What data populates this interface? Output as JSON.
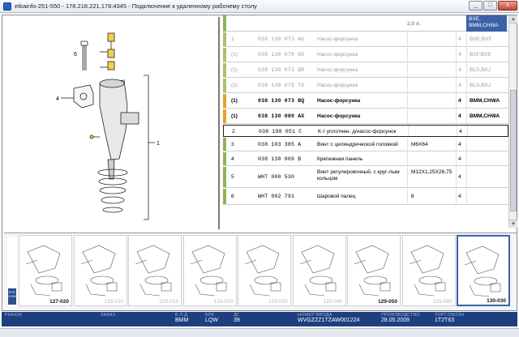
{
  "window": {
    "title": "etkainfo-251-550 - 178.218.221.178:4345 - Подключение к удаленному рабочему столу",
    "buttons": {
      "minimize": "_",
      "restore": "□",
      "close": "x"
    }
  },
  "parts_table": {
    "header": {
      "qualifier": "2,0 л.",
      "model": "BXE, BMM,CHWA"
    },
    "rows": [
      {
        "pos": "1",
        "part_number": "038 130 073 AG",
        "description": "Насос-форсунка",
        "qualifier": "",
        "qty": "4",
        "model": "BXE,BXF",
        "style": "grey",
        "mark": "#a9c06b"
      },
      {
        "pos": "(1)",
        "part_number": "038 130 079 GX",
        "description": "Насос-форсунка",
        "qualifier": "",
        "qty": "4",
        "model": "BXF,BXE",
        "style": "grey",
        "mark": "#a9c06b"
      },
      {
        "pos": "(1)",
        "part_number": "038 130 073 BR",
        "description": "Насос-форсунка",
        "qualifier": "",
        "qty": "4",
        "model": "BLS,BXJ",
        "style": "grey",
        "mark": "#a9c06b"
      },
      {
        "pos": "(1)",
        "part_number": "038 130 079 TX",
        "description": "Насос-форсунка",
        "qualifier": "",
        "qty": "4",
        "model": "BLS,BXJ",
        "style": "grey",
        "mark": "#a9c06b"
      },
      {
        "pos": "(1)",
        "part_number": "038 130 073 BQ",
        "description": "Насос-форсунка",
        "qualifier": "",
        "qty": "4",
        "model": "BMM,CHWA",
        "style": "bold",
        "mark": "#e5a12b"
      },
      {
        "pos": "(1)",
        "part_number": "038 130 080 AX",
        "description": "Насос-форсунка",
        "qualifier": "",
        "qty": "4",
        "model": "BMM,CHWA",
        "style": "bold",
        "mark": "#e5a12b"
      },
      {
        "pos": "2",
        "part_number": "038 198 051 C",
        "description": "К-т уплотнен. д/насос-форсунок",
        "qualifier": "",
        "qty": "4",
        "model": "",
        "style": "selected",
        "mark": "#ffffff"
      },
      {
        "pos": "3",
        "part_number": "038 103 385 A",
        "description": "Винт с цилиндрической головкой",
        "qualifier": "M6X64",
        "qty": "4",
        "model": "",
        "style": "normal",
        "mark": "#8fb255"
      },
      {
        "pos": "4",
        "part_number": "038 130 069 B",
        "description": "Крепежная панель",
        "qualifier": "",
        "qty": "4",
        "model": "",
        "style": "normal",
        "mark": "#8fb255"
      },
      {
        "pos": "5",
        "part_number": "WHT 000 530",
        "description": "Винт регулировочный, с круг-лым кольцом",
        "qualifier": "M12X1,25X26,75",
        "qty": "4",
        "model": "",
        "style": "normal",
        "mark": "#8fb255"
      },
      {
        "pos": "6",
        "part_number": "WHT 002 791",
        "description": "Шаровой палец",
        "qualifier": "8",
        "qty": "4",
        "model": "",
        "style": "normal",
        "mark": "#8fb255"
      }
    ]
  },
  "illustration": {
    "callouts": [
      "6",
      "4",
      "1"
    ]
  },
  "thumbnails": [
    {
      "label": "127-020",
      "active": false,
      "faded": false
    },
    {
      "label": "129-010",
      "active": false,
      "faded": true
    },
    {
      "label": "129-015",
      "active": false,
      "faded": true
    },
    {
      "label": "129-020",
      "active": false,
      "faded": true
    },
    {
      "label": "129-030",
      "active": false,
      "faded": true
    },
    {
      "label": "129-040",
      "active": false,
      "faded": true
    },
    {
      "label": "129-050",
      "active": false,
      "faded": false
    },
    {
      "label": "129-080",
      "active": false,
      "faded": true
    },
    {
      "label": "130-030",
      "active": true,
      "faded": false
    }
  ],
  "logo": {
    "text": "ETK COM"
  },
  "status_bar": {
    "market_label": "РЫНОК",
    "order_label": "ЗАКАЗ",
    "bld_label": "Б.Л.Д.",
    "bld_value": "BMM",
    "bpk_label": "БПК",
    "bpk_value": "LQW",
    "dg_label": "ДГ.",
    "dg_value": "39",
    "vin_label": "НОМЕР ВВОДА",
    "vin_value": "WVGZZZ1TZAW001224",
    "prod_label": "ПРОИЗВОДСТВО",
    "prod_value": "28.05.2009",
    "torg_label": "ТОРГ.ОБОЗН.",
    "torg_value": "1T2T63"
  },
  "colors": {
    "accent": "#3b62a8",
    "status_bg": "#1e3f7f",
    "mark_green": "#8fb255",
    "mark_orange": "#e5a12b"
  }
}
